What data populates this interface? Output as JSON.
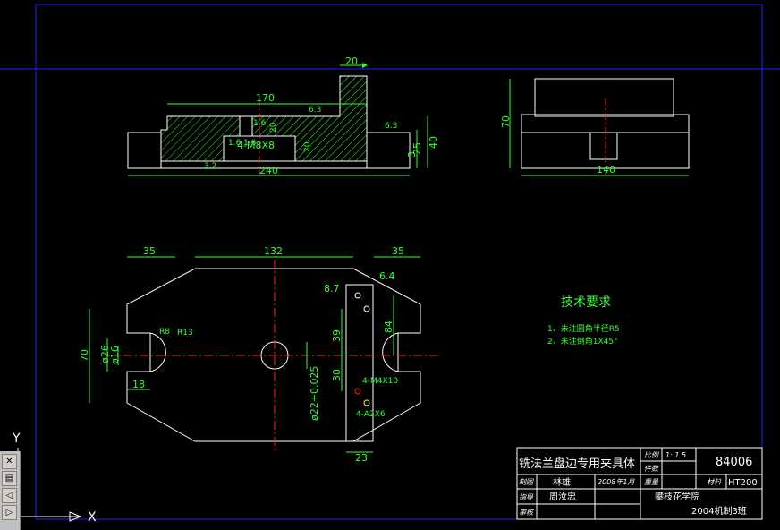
{
  "views": {
    "front": {
      "dims": [
        "20",
        "170",
        "240",
        "40",
        "25",
        "3",
        "20",
        "20",
        "4-M8X8"
      ],
      "roughness": [
        "6.3",
        "6.3",
        "1.6",
        "1.6",
        "1.6",
        "3.2",
        "6.3"
      ]
    },
    "side": {
      "dims": [
        "70",
        "140"
      ]
    },
    "top": {
      "dims": [
        "35",
        "132",
        "35",
        "6.4",
        "8.7",
        "R8",
        "R13",
        "70",
        "ø26",
        "ø16",
        "18",
        "39",
        "30",
        "84",
        "ø22+0.025",
        "4-M4X10",
        "4-A2X6",
        "23"
      ]
    }
  },
  "notes": {
    "title": "技术要求",
    "items": [
      "1、未注圆角半径R5",
      "2、未注倒角1X45°"
    ]
  },
  "title_block": {
    "name": "铣法兰盘边专用夹具体",
    "scale_label": "比例",
    "scale_value": "1: 1.5",
    "qty_label": "件数",
    "drawing_no": "84006",
    "drawn_label": "制图",
    "drawn_by": "林雄",
    "date": "2008年1月",
    "weight_label": "重量",
    "material_label": "材料",
    "material": "HT200",
    "instructor_label": "指导",
    "instructor": "周汝忠",
    "review_label": "审核",
    "school": "攀枝花学院",
    "class": "2004机制3班"
  },
  "ucs": {
    "x_label": "X",
    "y_label": "Y"
  },
  "colors": {
    "background": "#000000",
    "geometry": "#ffffff",
    "dimension": "#33ff33",
    "centerline": "#ff2020",
    "hatch": "#33ff33",
    "border": "#2020ff"
  },
  "toolbar": {
    "icons": [
      "close-icon",
      "layer-icon",
      "undo-icon",
      "redo-icon",
      "scroll-icon"
    ]
  }
}
